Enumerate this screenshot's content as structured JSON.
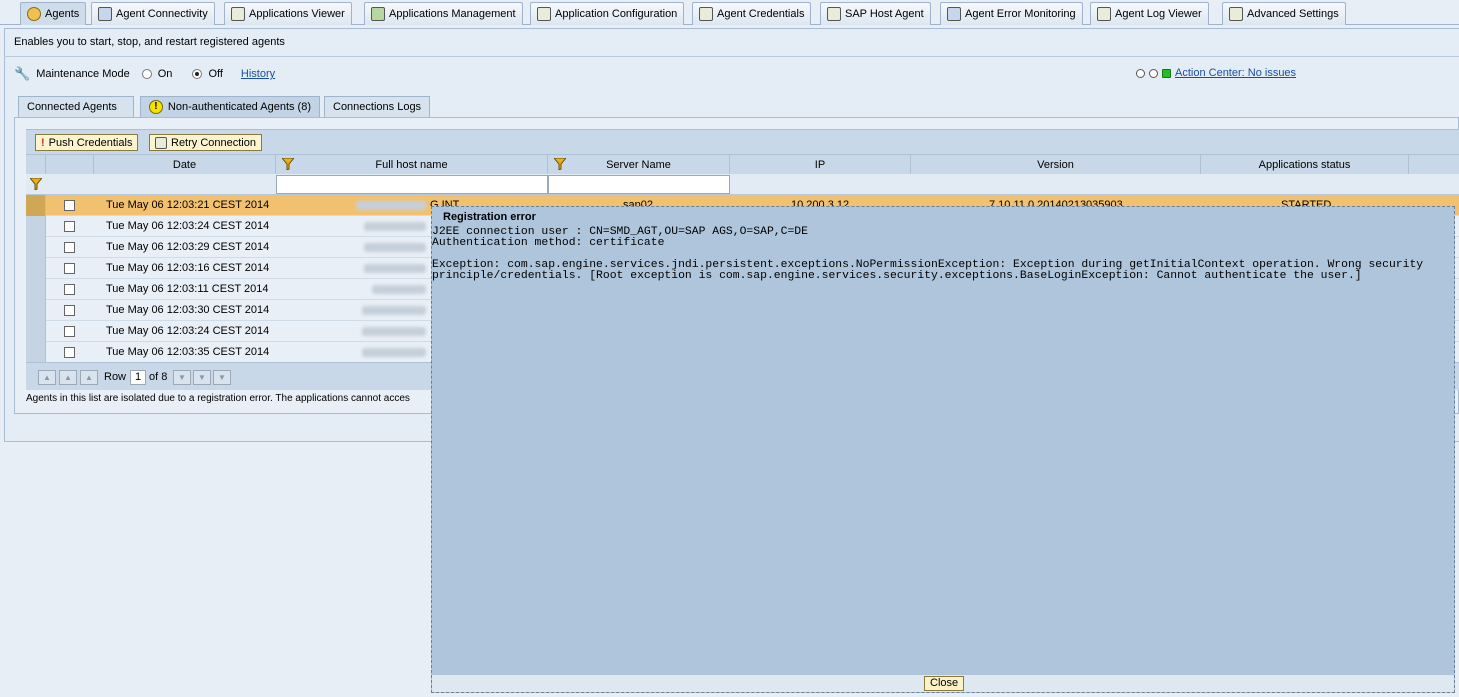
{
  "top_tabs": [
    {
      "label": "Agents",
      "icon": "agents-icon"
    },
    {
      "label": "Agent Connectivity",
      "icon": "connectivity-icon"
    },
    {
      "label": "Applications Viewer",
      "icon": "applications-viewer-icon"
    },
    {
      "label": "Applications Management",
      "icon": "applications-management-icon"
    },
    {
      "label": "Application Configuration",
      "icon": "application-configuration-icon"
    },
    {
      "label": "Agent Credentials",
      "icon": "agent-credentials-icon"
    },
    {
      "label": "SAP Host Agent",
      "icon": "sap-host-agent-icon"
    },
    {
      "label": "Agent Error Monitoring",
      "icon": "agent-error-monitoring-icon"
    },
    {
      "label": "Agent Log Viewer",
      "icon": "agent-log-viewer-icon"
    },
    {
      "label": "Advanced Settings",
      "icon": "advanced-settings-icon"
    }
  ],
  "description": "Enables you to start, stop, and restart registered agents",
  "maintenance": {
    "label": "Maintenance Mode",
    "on_label": "On",
    "off_label": "Off",
    "selected": "Off",
    "history_link": "History"
  },
  "action_center": {
    "link": "Action Center: No issues",
    "status_color": "#22c022"
  },
  "sub_tabs": [
    {
      "label": "Connected Agents"
    },
    {
      "label": "Non-authenticated Agents (8)",
      "icon": "warning-icon"
    },
    {
      "label": "Connections Logs"
    }
  ],
  "toolbar": {
    "push_credentials": "Push Credentials",
    "retry_connection": "Retry Connection"
  },
  "columns": [
    "Date",
    "Full host name",
    "Server Name",
    "IP",
    "Version",
    "Applications status"
  ],
  "rows": [
    {
      "date": "Tue May 06 12:03:21 CEST 2014",
      "host_suffix": "G.INT",
      "server": "sap02",
      "ip": "10.200.3.12",
      "version": "7.10.11.0.20140213035903",
      "status": "STARTED",
      "selected": true
    },
    {
      "date": "Tue May 06 12:03:24 CEST 2014"
    },
    {
      "date": "Tue May 06 12:03:29 CEST 2014"
    },
    {
      "date": "Tue May 06 12:03:16 CEST 2014"
    },
    {
      "date": "Tue May 06 12:03:11 CEST 2014"
    },
    {
      "date": "Tue May 06 12:03:30 CEST 2014"
    },
    {
      "date": "Tue May 06 12:03:24 CEST 2014"
    },
    {
      "date": "Tue May 06 12:03:35 CEST 2014"
    }
  ],
  "pager": {
    "row_label": "Row",
    "current": "1",
    "of_text": "of 8"
  },
  "footnote": "Agents in this list are isolated due to a registration error. The applications cannot acces",
  "popup": {
    "title": "Registration error",
    "body": "J2EE connection user : CN=SMD_AGT,OU=SAP AGS,O=SAP,C=DE\nAuthentication method: certificate\n\nException: com.sap.engine.services.jndi.persistent.exceptions.NoPermissionException: Exception during getInitialContext operation. Wrong security principle/credentials. [Root exception is com.sap.engine.services.security.exceptions.BaseLoginException: Cannot authenticate the user.]",
    "close_label": "Close"
  }
}
